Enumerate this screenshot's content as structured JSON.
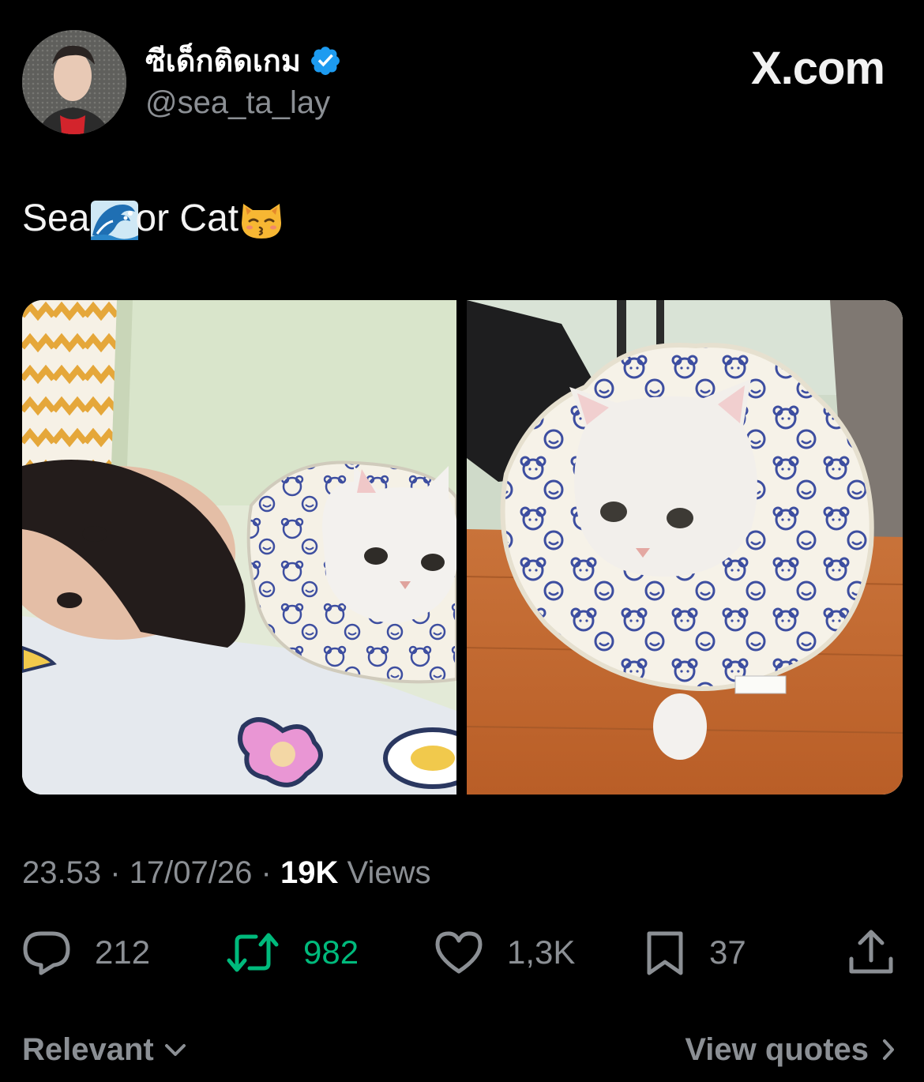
{
  "author": {
    "display_name": "ซีเด็กติดเกม",
    "handle": "@sea_ta_lay",
    "verified_icon": "verified-badge-icon",
    "verified_color": "#1d9bf0"
  },
  "brand": {
    "label": "X.com"
  },
  "tweet": {
    "text_part1": "Sea",
    "emoji1": "water-wave-emoji",
    "text_part2": " or Cat",
    "emoji2": "kissing-cat-emoji"
  },
  "media": {
    "left_image": "selfie-with-cat-in-cone-photo",
    "right_image": "cat-in-cone-photo"
  },
  "meta": {
    "time": "23.53",
    "separator": "·",
    "date": "17/07/26",
    "views_count": "19K",
    "views_label": "Views"
  },
  "actions": {
    "replies": {
      "icon": "reply-icon",
      "count": "212"
    },
    "retweets": {
      "icon": "retweet-icon",
      "count": "982",
      "color": "#00ba7c"
    },
    "likes": {
      "icon": "heart-icon",
      "count": "1,3K"
    },
    "bookmarks": {
      "icon": "bookmark-icon",
      "count": "37"
    },
    "share": {
      "icon": "share-icon"
    }
  },
  "footer": {
    "sort_label": "Relevant",
    "quotes_label": "View quotes"
  }
}
